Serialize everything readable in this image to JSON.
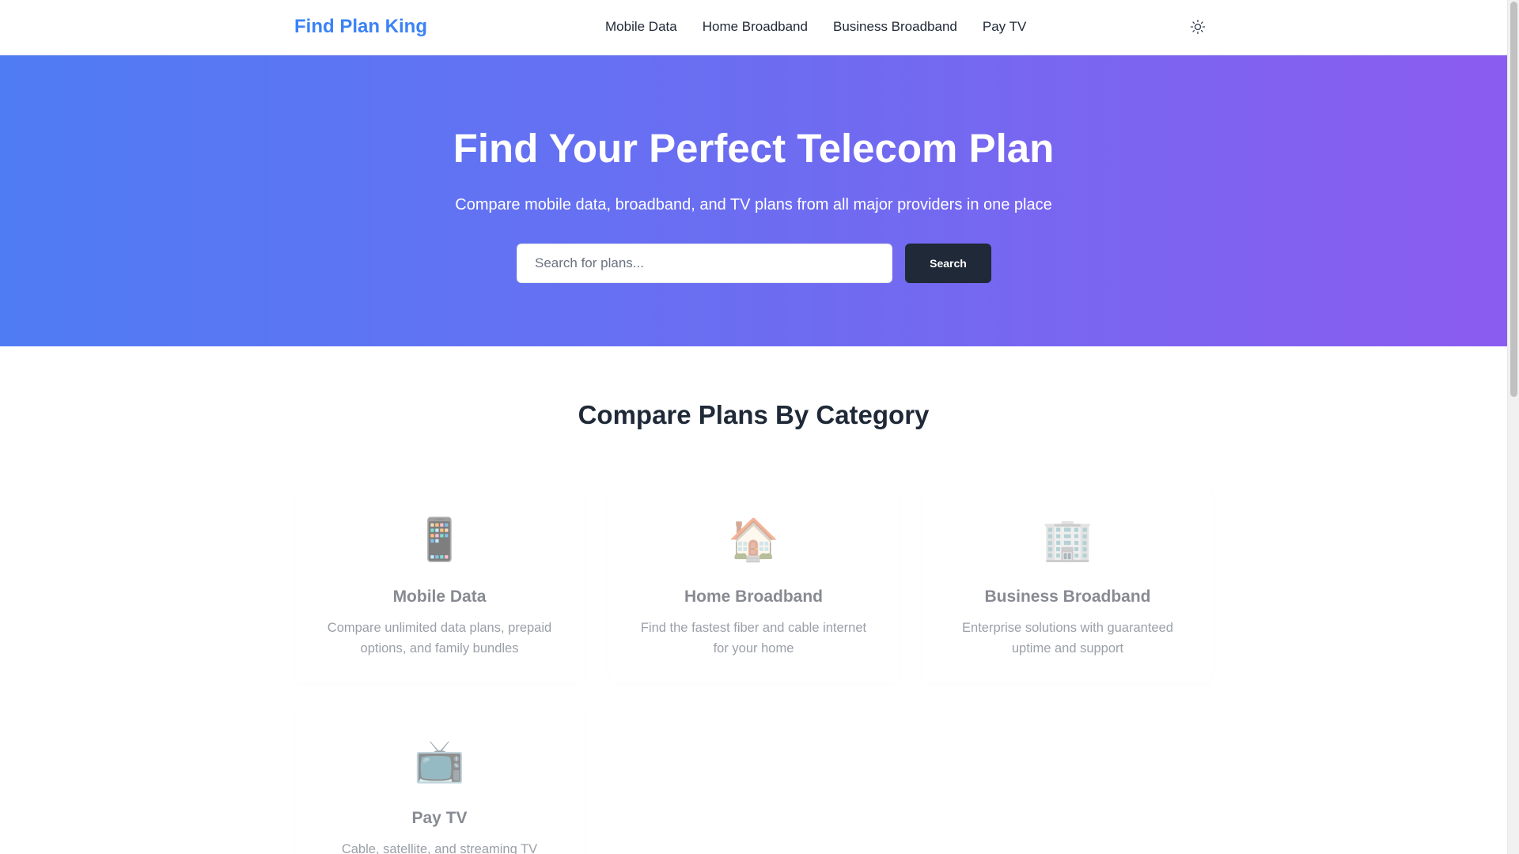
{
  "header": {
    "brand": "Find Plan King",
    "nav": [
      "Mobile Data",
      "Home Broadband",
      "Business Broadband",
      "Pay TV"
    ],
    "theme_toggle_icon": "sun-icon"
  },
  "hero": {
    "title": "Find Your Perfect Telecom Plan",
    "subtitle": "Compare mobile data, broadband, and TV plans from all major providers in one place",
    "search_placeholder": "Search for plans...",
    "search_button": "Search",
    "gradient_start": "#4f7cf3",
    "gradient_end": "#8b5cf0"
  },
  "categories": {
    "title": "Compare Plans By Category",
    "items": [
      {
        "icon": "📱",
        "icon_name": "mobile-phone-icon",
        "title": "Mobile Data",
        "desc": "Compare unlimited data plans, prepaid options, and family bundles"
      },
      {
        "icon": "🏠",
        "icon_name": "house-icon",
        "title": "Home Broadband",
        "desc": "Find the fastest fiber and cable internet for your home"
      },
      {
        "icon": "🏢",
        "icon_name": "office-building-icon",
        "title": "Business Broadband",
        "desc": "Enterprise solutions with guaranteed uptime and support"
      },
      {
        "icon": "📺",
        "icon_name": "television-icon",
        "title": "Pay TV",
        "desc": "Cable, satellite, and streaming TV"
      }
    ]
  },
  "colors": {
    "brand": "#3b82f6",
    "button_dark": "#1f2937",
    "text": "#1f2937"
  }
}
